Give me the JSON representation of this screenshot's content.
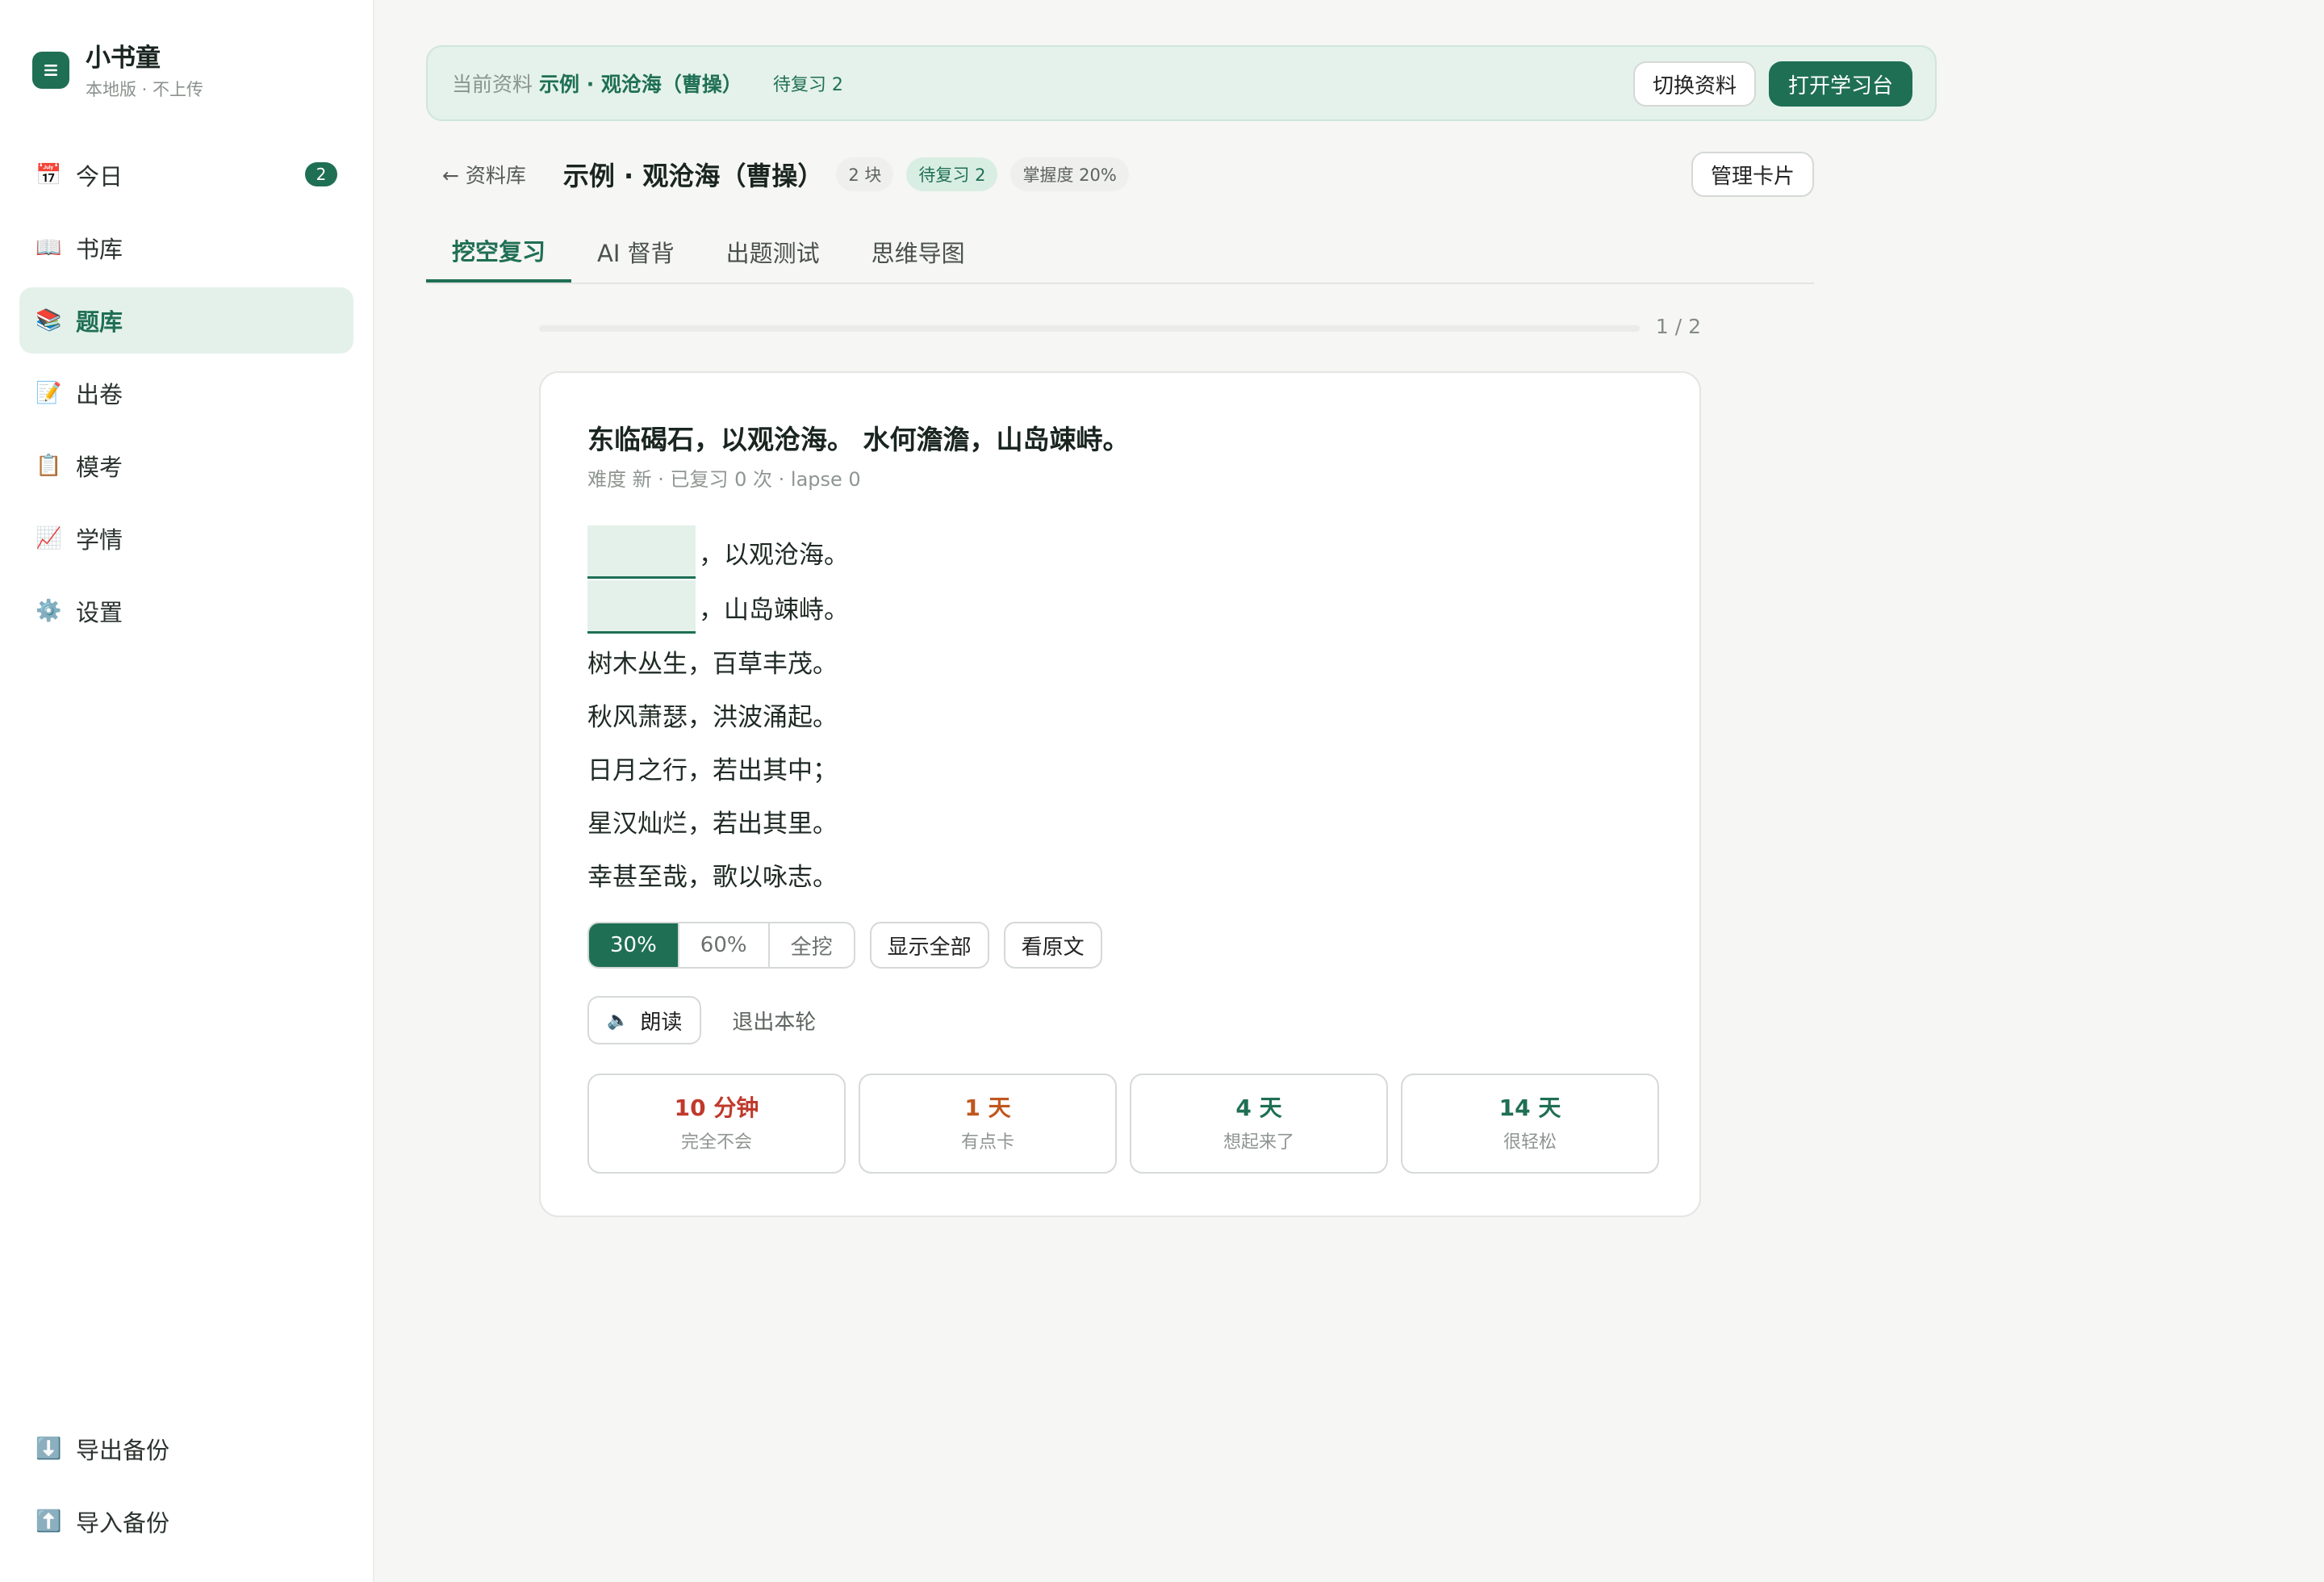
{
  "sidebar": {
    "app_name": "小书童",
    "app_sub": "本地版 · 不上传",
    "items": [
      {
        "icon": "📅",
        "icon_name": "calendar-icon",
        "label": "今日",
        "badge": "2"
      },
      {
        "icon": "📖",
        "icon_name": "book-icon",
        "label": "书库"
      },
      {
        "icon": "📚",
        "icon_name": "books-icon",
        "label": "题库",
        "active": true
      },
      {
        "icon": "📝",
        "icon_name": "memo-icon",
        "label": "出卷"
      },
      {
        "icon": "📋",
        "icon_name": "clipboard-icon",
        "label": "模考"
      },
      {
        "icon": "📈",
        "icon_name": "chart-icon",
        "label": "学情"
      },
      {
        "icon": "⚙️",
        "icon_name": "gear-icon",
        "label": "设置"
      }
    ],
    "bottom": [
      {
        "icon": "⬇️",
        "icon_name": "download-icon",
        "label": "导出备份"
      },
      {
        "icon": "⬆️",
        "icon_name": "upload-icon",
        "label": "导入备份"
      }
    ]
  },
  "banner": {
    "label": "当前资料",
    "title": "示例 · 观沧海（曹操）",
    "pending": "待复习 2",
    "switch_label": "切换资料",
    "open_label": "打开学习台"
  },
  "header": {
    "back_label": "← 资料库",
    "title": "示例 · 观沧海（曹操）",
    "pill_blocks": "2 块",
    "pill_pending": "待复习 2",
    "pill_mastery": "掌握度 20%",
    "manage_label": "管理卡片"
  },
  "tabs": [
    "挖空复习",
    "AI 督背",
    "出题测试",
    "思维导图"
  ],
  "progress": {
    "text": "1 / 2",
    "fraction": 0
  },
  "card": {
    "title": "东临碣石，以观沧海。 水何澹澹，山岛竦峙。",
    "meta": "难度 新 · 已复习 0 次 · lapse 0",
    "blank_lines": [
      "，以观沧海。",
      "，山岛竦峙。"
    ],
    "lines": [
      "树木丛生，百草丰茂。",
      "秋风萧瑟，洪波涌起。",
      "日月之行，若出其中；",
      "星汉灿烂，若出其里。",
      "幸甚至哉，歌以咏志。"
    ],
    "seg": [
      "30%",
      "60%",
      "全挖"
    ],
    "show_all": "显示全部",
    "view_original": "看原文",
    "read_label": "朗读",
    "exit_label": "退出本轮",
    "ratings": [
      {
        "time": "10 分钟",
        "desc": "完全不会",
        "color": "#c0392b"
      },
      {
        "time": "1 天",
        "desc": "有点卡",
        "color": "#c0571f"
      },
      {
        "time": "4 天",
        "desc": "想起来了",
        "color": "#1f6f55"
      },
      {
        "time": "14 天",
        "desc": "很轻松",
        "color": "#1f6f55"
      }
    ]
  }
}
